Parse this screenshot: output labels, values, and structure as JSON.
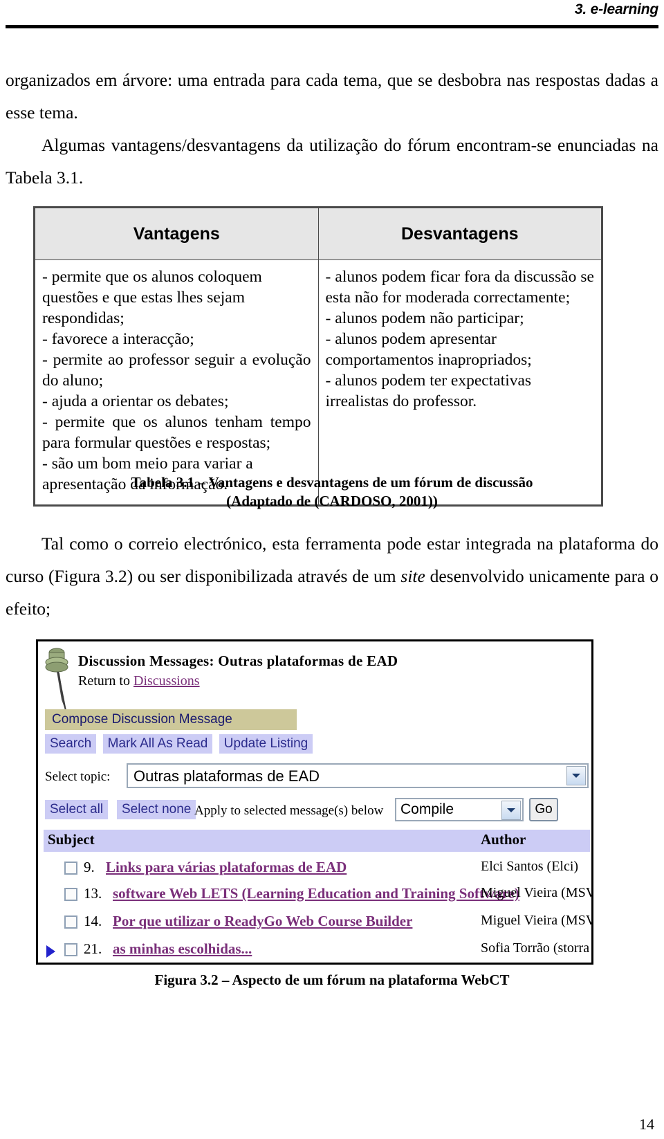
{
  "header": {
    "running_head": "3. e-learning"
  },
  "body": {
    "para1": "organizados em árvore: uma entrada para cada tema, que se desbobra nas respostas dadas a esse tema.",
    "para2": "Algumas vantagens/desvantagens da utilização do fórum encontram-se enunciadas na Tabela 3.1.",
    "para3_a": "Tal como o correio electrónico, esta ferramenta pode estar integrada na plataforma do curso (Figura 3.2) ou ser disponibilizada através de um ",
    "para3_ital": "site",
    "para3_b": " desenvolvido unicamente para o efeito;"
  },
  "table": {
    "headers": [
      "Vantagens",
      "Desvantagens"
    ],
    "advantages": "- permite que os alunos coloquem questões e que estas lhes sejam respondidas;\n- favorece a interacção;\n- permite ao professor seguir a evolução do aluno;\n- ajuda a orientar os debates;\n- permite que os alunos tenham tempo para formular questões e respostas;\n- são um bom meio para variar a apresentação da informação.",
    "advantages_lines": [
      "- permite que os alunos coloquem questões e que estas lhes sejam respondidas;",
      "- favorece a interacção;",
      "- permite ao professor seguir a evolução do aluno;",
      "- ajuda a orientar os debates;",
      "- permite que os alunos tenham tempo para formular questões e respostas;",
      "- são um bom meio para variar a apresentação da informação."
    ],
    "disadvantages_lines": [
      "- alunos podem ficar fora da discussão se esta não for moderada correctamente;",
      "- alunos podem não participar;",
      "- alunos podem apresentar comportamentos inapropriados;",
      "- alunos podem ter expectativas irrealistas do professor."
    ],
    "caption_line1": "Tabela 3.1 – Vantagens e desvantagens de um fórum de discussão",
    "caption_line2": "(Adaptado de (CARDOSO, 2001))"
  },
  "screenshot": {
    "title": "Discussion Messages: Outras plataformas de EAD",
    "return_prefix": "Return to ",
    "return_link": "Discussions",
    "compose_button": "Compose Discussion Message",
    "buttons": [
      "Search",
      "Mark All As Read",
      "Update Listing"
    ],
    "topic_label": "Select topic:",
    "topic_value": "Outras plataformas de EAD",
    "select_all": "Select all",
    "select_none": "Select none",
    "apply_text": "Apply to selected message(s) below",
    "action_value": "Compile",
    "go_button": "Go",
    "columns": [
      "Subject",
      "Author"
    ],
    "messages": [
      {
        "num": "9.",
        "subject": "Links para várias plataformas de EAD",
        "author": "Elci Santos (Elci)",
        "flagged": false
      },
      {
        "num": "13.",
        "subject": "software Web LETS (Learning Education and Training Software)",
        "author": "Miguel Vieira (MSV",
        "flagged": false
      },
      {
        "num": "14.",
        "subject": "Por que utilizar o ReadyGo Web Course Builder",
        "author": "Miguel Vieira (MSV",
        "flagged": false
      },
      {
        "num": "21.",
        "subject": "as minhas escolhidas...",
        "author": "Sofia Torrão (storra",
        "flagged": true
      }
    ]
  },
  "figure": {
    "caption": "Figura 3.2 – Aspecto de um fórum na plataforma WebCT"
  },
  "footer": {
    "page_number": "14"
  },
  "colors": {
    "compose_bar": "#cdc89a",
    "button_lilac": "#ccccf5",
    "link_purple": "#7a2f7a",
    "table_header_gray": "#e6e6e6"
  }
}
